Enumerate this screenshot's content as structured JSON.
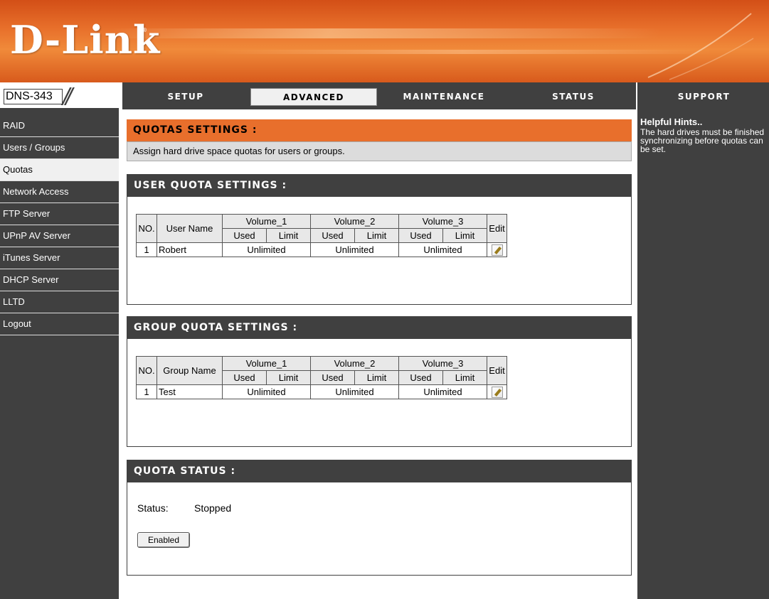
{
  "brand": {
    "logo": "D-Link",
    "registered": "®",
    "model": "DNS-343",
    "model_slash": "//"
  },
  "tabs": [
    {
      "label": "SETUP",
      "active": false
    },
    {
      "label": "ADVANCED",
      "active": true
    },
    {
      "label": "MAINTENANCE",
      "active": false
    },
    {
      "label": "STATUS",
      "active": false
    }
  ],
  "support_tab": "SUPPORT",
  "sidebar": {
    "items": [
      {
        "label": "RAID",
        "active": false
      },
      {
        "label": "Users / Groups",
        "active": false
      },
      {
        "label": "Quotas",
        "active": true
      },
      {
        "label": "Network Access",
        "active": false
      },
      {
        "label": "FTP Server",
        "active": false
      },
      {
        "label": "UPnP AV Server",
        "active": false
      },
      {
        "label": "iTunes Server",
        "active": false
      },
      {
        "label": "DHCP Server",
        "active": false
      },
      {
        "label": "LLTD",
        "active": false
      },
      {
        "label": "Logout",
        "active": false
      }
    ]
  },
  "quotas": {
    "title": "QUOTAS SETTINGS :",
    "description": "Assign hard drive space quotas for users or groups."
  },
  "user_quota": {
    "title": "USER QUOTA SETTINGS :",
    "headers": {
      "no": "NO.",
      "name": "User Name",
      "vol1": "Volume_1",
      "vol2": "Volume_2",
      "vol3": "Volume_3",
      "used": "Used",
      "limit": "Limit",
      "edit": "Edit"
    },
    "rows": [
      {
        "no": "1",
        "name": "Robert",
        "vol1": "Unlimited",
        "vol2": "Unlimited",
        "vol3": "Unlimited"
      }
    ]
  },
  "group_quota": {
    "title": "GROUP QUOTA SETTINGS :",
    "headers": {
      "no": "NO.",
      "name": "Group Name",
      "vol1": "Volume_1",
      "vol2": "Volume_2",
      "vol3": "Volume_3",
      "used": "Used",
      "limit": "Limit",
      "edit": "Edit"
    },
    "rows": [
      {
        "no": "1",
        "name": "Test",
        "vol1": "Unlimited",
        "vol2": "Unlimited",
        "vol3": "Unlimited"
      }
    ]
  },
  "quota_status": {
    "title": "QUOTA STATUS :",
    "status_label": "Status:",
    "status_value": "Stopped",
    "button_label": "Enabled"
  },
  "hints": {
    "title": "Helpful Hints..",
    "text": "The hard drives must be finished synchronizing before quotas can be set."
  },
  "colors": {
    "accent": "#e86f2c",
    "panel_dark": "#404040",
    "header_orange": "#d34f17"
  },
  "icons": {
    "edit": "edit-icon"
  }
}
